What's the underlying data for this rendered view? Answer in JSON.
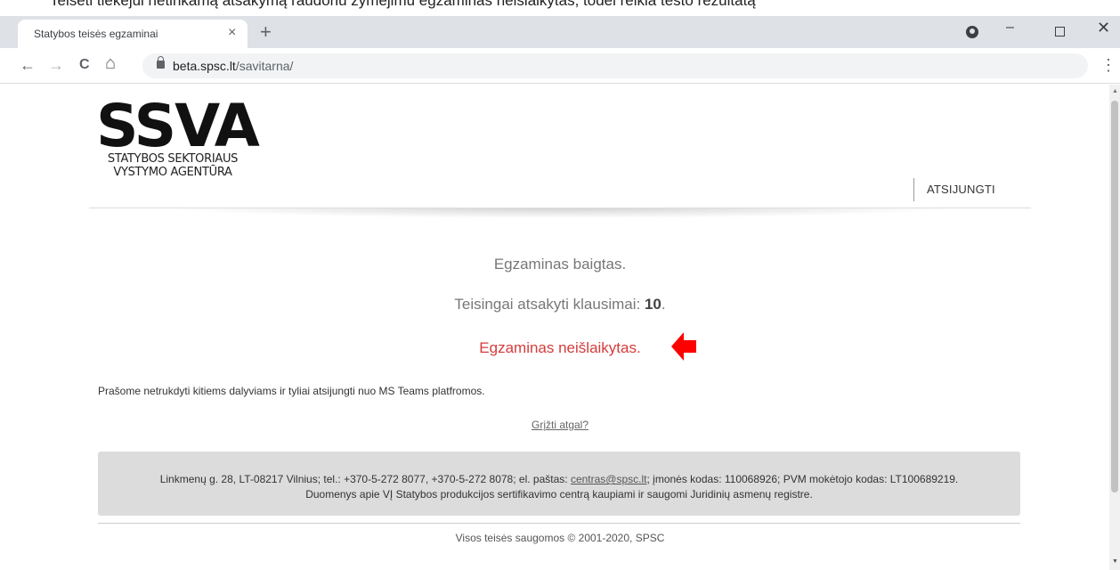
{
  "doc_strip": {
    "text": "Teisėti tiekėjui netinkamą atsakymą raudonu žymėjimu egzaminas neišlaikytas, todėl reikia testo rezultatą"
  },
  "browser": {
    "tab_title": "Statybos teisės egzaminai",
    "tab_close": "×",
    "new_tab": "+",
    "url_host": "beta.spsc.lt",
    "url_path": "/savitarna/",
    "nav": {
      "back": "←",
      "forward": "→",
      "reload": "C",
      "home": "⌂",
      "menu": "⋮"
    },
    "window": {
      "minimize": "–",
      "close": "✕"
    }
  },
  "header": {
    "logo_text": "SSVA",
    "logo_sub_line1": "STATYBOS SEKTORIAUS",
    "logo_sub_line2": "VYSTYMO AGENTŪRA",
    "logout": "ATSIJUNGTI"
  },
  "result": {
    "finished": "Egzaminas baigtas.",
    "correct_label": "Teisingai atsakyti klausimai: ",
    "correct_count": "10",
    "correct_suffix": ".",
    "status": "Egzaminas neišlaikytas."
  },
  "notice": "Prašome netrukdyti kitiems dalyviams ir tyliai atsijungti nuo MS Teams platfromos.",
  "back_link": "Grįžti atgal?",
  "footer": {
    "line1_before": "Linkmenų g. 28, LT-08217 Vilnius; tel.: +370-5-272 8077, +370-5-272 8078; el. paštas: ",
    "email": "centras@spsc.lt",
    "line1_after": "; įmonės kodas: 110068926; PVM mokėtojo kodas: LT100689219.",
    "line2": "Duomenys apie VĮ Statybos produkcijos sertifikavimo centrą kaupiami ir saugomi Juridinių asmenų registre.",
    "copyright": "Visos teisės saugomos © 2001-2020, SPSC"
  },
  "colors": {
    "status_red": "#d53c3c",
    "arrow_red": "#ff0000",
    "tabbar": "#dee1e6",
    "footer_bg": "#dcdcdc"
  }
}
